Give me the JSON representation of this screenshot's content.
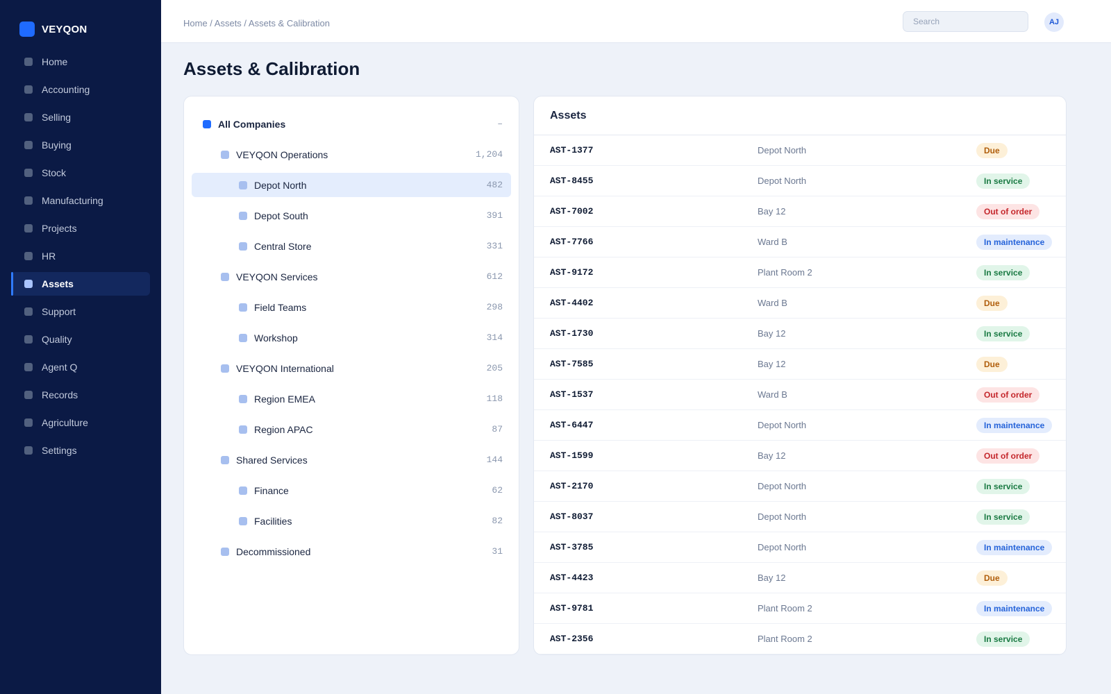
{
  "app": {
    "brand": "VEYQON"
  },
  "sidebar": {
    "items": [
      {
        "label": "Home",
        "active": false
      },
      {
        "label": "Accounting",
        "active": false
      },
      {
        "label": "Selling",
        "active": false
      },
      {
        "label": "Buying",
        "active": false
      },
      {
        "label": "Stock",
        "active": false
      },
      {
        "label": "Manufacturing",
        "active": false
      },
      {
        "label": "Projects",
        "active": false
      },
      {
        "label": "HR",
        "active": false
      },
      {
        "label": "Assets",
        "active": true
      },
      {
        "label": "Support",
        "active": false
      },
      {
        "label": "Quality",
        "active": false
      },
      {
        "label": "Agent Q",
        "active": false
      },
      {
        "label": "Records",
        "active": false
      },
      {
        "label": "Agriculture",
        "active": false
      },
      {
        "label": "Settings",
        "active": false
      }
    ]
  },
  "header": {
    "breadcrumb": "Home / Assets / Assets & Calibration",
    "search_placeholder": "Search",
    "avatar_initials": "AJ"
  },
  "page": {
    "title": "Assets & Calibration"
  },
  "tree": {
    "nodes": [
      {
        "label": "All Companies",
        "count": "–",
        "level": 0,
        "selected": false
      },
      {
        "label": "VEYQON Operations",
        "count": "1,204",
        "level": 1,
        "selected": false
      },
      {
        "label": "Depot North",
        "count": "482",
        "level": 2,
        "selected": true
      },
      {
        "label": "Depot South",
        "count": "391",
        "level": 2,
        "selected": false
      },
      {
        "label": "Central Store",
        "count": "331",
        "level": 2,
        "selected": false
      },
      {
        "label": "VEYQON Services",
        "count": "612",
        "level": 1,
        "selected": false
      },
      {
        "label": "Field Teams",
        "count": "298",
        "level": 2,
        "selected": false
      },
      {
        "label": "Workshop",
        "count": "314",
        "level": 2,
        "selected": false
      },
      {
        "label": "VEYQON International",
        "count": "205",
        "level": 1,
        "selected": false
      },
      {
        "label": "Region EMEA",
        "count": "118",
        "level": 2,
        "selected": false
      },
      {
        "label": "Region APAC",
        "count": "87",
        "level": 2,
        "selected": false
      },
      {
        "label": "Shared Services",
        "count": "144",
        "level": 1,
        "selected": false
      },
      {
        "label": "Finance",
        "count": "62",
        "level": 2,
        "selected": false
      },
      {
        "label": "Facilities",
        "count": "82",
        "level": 2,
        "selected": false
      },
      {
        "label": "Decommissioned",
        "count": "31",
        "level": 1,
        "selected": false
      }
    ]
  },
  "assets": {
    "title": "Assets",
    "rows": [
      {
        "id": "AST-1377",
        "location": "Depot North",
        "status": "Due"
      },
      {
        "id": "AST-8455",
        "location": "Depot North",
        "status": "In service"
      },
      {
        "id": "AST-7002",
        "location": "Bay 12",
        "status": "Out of order"
      },
      {
        "id": "AST-7766",
        "location": "Ward B",
        "status": "In maintenance"
      },
      {
        "id": "AST-9172",
        "location": "Plant Room 2",
        "status": "In service"
      },
      {
        "id": "AST-4402",
        "location": "Ward B",
        "status": "Due"
      },
      {
        "id": "AST-1730",
        "location": "Bay 12",
        "status": "In service"
      },
      {
        "id": "AST-7585",
        "location": "Bay 12",
        "status": "Due"
      },
      {
        "id": "AST-1537",
        "location": "Ward B",
        "status": "Out of order"
      },
      {
        "id": "AST-6447",
        "location": "Depot North",
        "status": "In maintenance"
      },
      {
        "id": "AST-1599",
        "location": "Bay 12",
        "status": "Out of order"
      },
      {
        "id": "AST-2170",
        "location": "Depot North",
        "status": "In service"
      },
      {
        "id": "AST-8037",
        "location": "Depot North",
        "status": "In service"
      },
      {
        "id": "AST-3785",
        "location": "Depot North",
        "status": "In maintenance"
      },
      {
        "id": "AST-4423",
        "location": "Bay 12",
        "status": "Due"
      },
      {
        "id": "AST-9781",
        "location": "Plant Room 2",
        "status": "In maintenance"
      },
      {
        "id": "AST-2356",
        "location": "Plant Room 2",
        "status": "In service"
      }
    ]
  },
  "colors": {
    "sidebar_bg": "#0b1a45",
    "accent": "#1f6bff",
    "status_due": "#b05e0c",
    "status_in_service": "#1a7a43",
    "status_out_of_order": "#c4262b",
    "status_in_maintenance": "#2563d9"
  }
}
